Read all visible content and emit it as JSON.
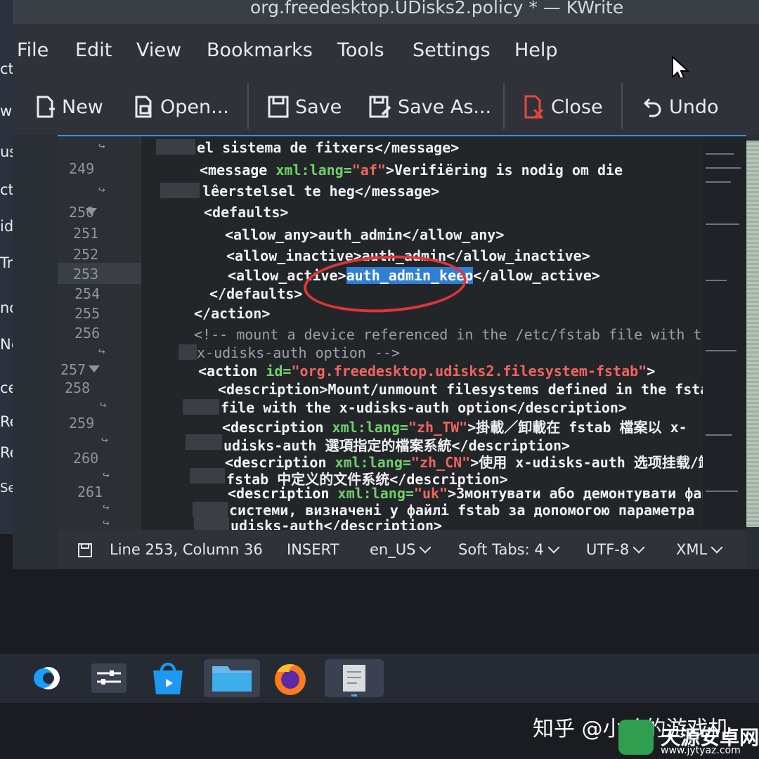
{
  "window": {
    "title": "org.freedesktop.UDisks2.policy * — KWrite"
  },
  "desktop": {
    "items": [
      "ct",
      "w",
      "usi",
      "ctu",
      "ide",
      "Trash",
      "note",
      "Netv",
      "cent",
      "Rece",
      "Rece",
      "Search Fo"
    ]
  },
  "menu": {
    "items": [
      "File",
      "Edit",
      "View",
      "Bookmarks",
      "Tools",
      "Settings",
      "Help"
    ]
  },
  "toolbar": {
    "new": "New",
    "open": "Open...",
    "save": "Save",
    "save_as": "Save As...",
    "close": "Close",
    "undo": "Undo"
  },
  "editor": {
    "line_numbers": [
      "249",
      "250",
      "251",
      "252",
      "253",
      "254",
      "255",
      "256",
      "257",
      "258",
      "259",
      "260",
      "261"
    ],
    "code": {
      "l0": "el sistema de fitxers</message>",
      "l1_tag": "<message",
      "l1_attr": " xml:lang=",
      "l1_val": "\"af\"",
      "l1_text": ">Verifiëring is nodig om die",
      "l2": "lêerstelsel te heg</message>",
      "l3": "<defaults>",
      "l4": "<allow_any>auth_admin</allow_any>",
      "l5": "<allow_inactive>auth_admin</allow_inactive>",
      "l6_open": "<allow_active>",
      "l6_sel": "auth_admin_keep",
      "l6_close": "</allow_active>",
      "l7": "</defaults>",
      "l8": "</action>",
      "l9": "<!-- mount a device referenced in the /etc/fstab file with the",
      "l10": "x-udisks-auth option -->",
      "l11_tag": "<action",
      "l11_attr": " id=",
      "l11_val": "\"org.freedesktop.udisks2.filesystem-fstab\"",
      "l11_end": ">",
      "l12": "<description>Mount/unmount filesystems defined in the fstab",
      "l13": "file with the x-udisks-auth option</description>",
      "l14_tag": "<description",
      "l14_attr": " xml:lang=",
      "l14_val": "\"zh_TW\"",
      "l14_text": ">掛載／卸載在 fstab 檔案以 x-",
      "l15": "udisks-auth 選項指定的檔案系統</description>",
      "l16_tag": "<description",
      "l16_attr": " xml:lang=",
      "l16_val": "\"zh_CN\"",
      "l16_text": ">使用 x-udisks-auth 选项挂载/卸载",
      "l17": "fstab 中定义的文件系统</description>",
      "l18_tag": "<description",
      "l18_attr": " xml:lang=",
      "l18_val": "\"uk\"",
      "l18_text": ">Змонтувати або демонтувати файлові",
      "l19": "системи, визначені у файлі fstab за допомогою параметра x-",
      "l20": "udisks-auth</description>"
    }
  },
  "statusbar": {
    "position": "Line 253, Column 36",
    "mode": "INSERT",
    "language": "en_US",
    "indent": "Soft Tabs: 4",
    "encoding": "UTF-8",
    "syntax": "XML"
  },
  "watermark": {
    "zhihu": "知乎 @小哈的游戏机",
    "site": "天源安卓网",
    "url": "www.jytyaz.com"
  },
  "colors": {
    "tag": "#f4f5f7",
    "attr": "#6fd06a",
    "value": "#f2645e",
    "selection": "#2f7fd3",
    "annotation": "#e0353a"
  }
}
